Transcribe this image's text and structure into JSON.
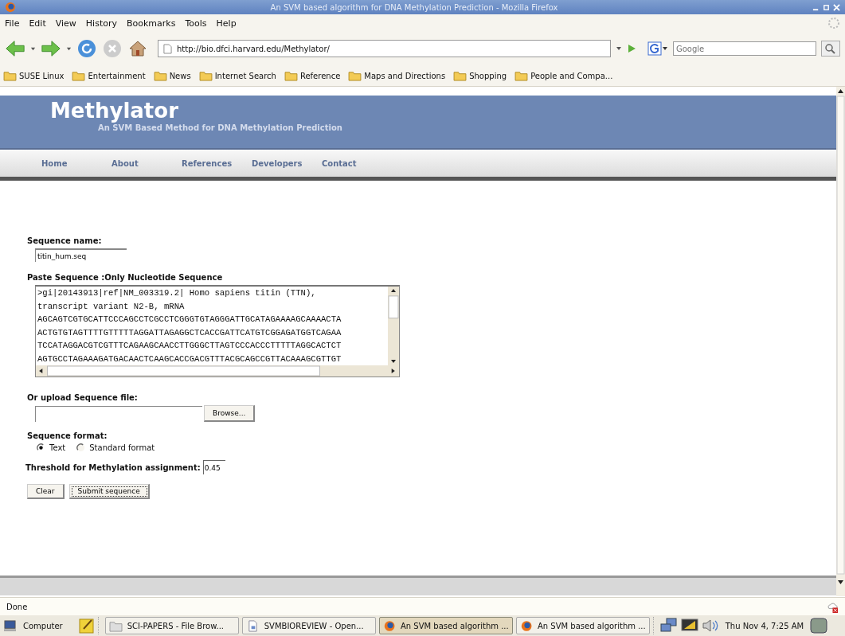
{
  "window": {
    "title": "An SVM based algorithm for DNA Methylation Prediction - Mozilla Firefox"
  },
  "menu": [
    "File",
    "Edit",
    "View",
    "History",
    "Bookmarks",
    "Tools",
    "Help"
  ],
  "toolbar": {
    "url": "http://bio.dfci.harvard.edu/Methylator/",
    "search_placeholder": "Google"
  },
  "bookmarks": [
    "SUSE Linux",
    "Entertainment",
    "News",
    "Internet Search",
    "Reference",
    "Maps and Directions",
    "Shopping",
    "People and Compa..."
  ],
  "site": {
    "title": "Methylator",
    "subtitle": "An SVM Based Method for DNA Methylation Prediction",
    "nav": [
      "Home",
      "About",
      "References",
      "Developers",
      "Contact"
    ]
  },
  "form": {
    "name_label": "Sequence name:",
    "name_value": "titin_hum.seq",
    "paste_label": "Paste Sequence :Only Nucleotide Sequence",
    "sequence_lines": [
      ">gi|20143913|ref|NM_003319.2| Homo sapiens titin (TTN),",
      "transcript variant N2-B, mRNA",
      "AGCAGTCGTGCATTCCCAGCCTCGCCTCGGGTGTAGGGATTGCATAGAAAAGCAAAACTA",
      "ACTGTGTAGTTTTGTTTTTAGGATTAGAGGCTCACCGATTCATGTCGGAGATGGTCAGAA",
      "TCCATAGGACGTCGTTTCAGAAGCAACCTTGGGCTTAGTCCCACCCTTTTTAGGCACTCT",
      "AGTGCCTAGAAAGATGACAACTCAAGCACCGACGTTTACGCAGCCGTTACAAAGCGTTGT"
    ],
    "upload_label": "Or upload Sequence file:",
    "browse": "Browse...",
    "format_label": "Sequence format:",
    "formats": [
      {
        "label": "Text",
        "selected": true
      },
      {
        "label": "Standard format",
        "selected": false
      }
    ],
    "threshold_label": "Threshold for Methylation assignment:",
    "threshold_value": "0.45",
    "buttons": [
      "Clear",
      "Submit sequence"
    ]
  },
  "status": "Done",
  "taskbar": {
    "start": "Computer",
    "tasks": [
      {
        "label": "SCI-PAPERS - File Brow...",
        "kind": "folder",
        "selected": false
      },
      {
        "label": "SVMBIOREVIEW - Open...",
        "kind": "document",
        "selected": false
      },
      {
        "label": "An SVM based algorithm ...",
        "kind": "browser",
        "selected": true
      },
      {
        "label": "An SVM based algorithm ...",
        "kind": "browser",
        "selected": false
      }
    ],
    "clock": "Thu Nov 4,  7:25 AM"
  }
}
